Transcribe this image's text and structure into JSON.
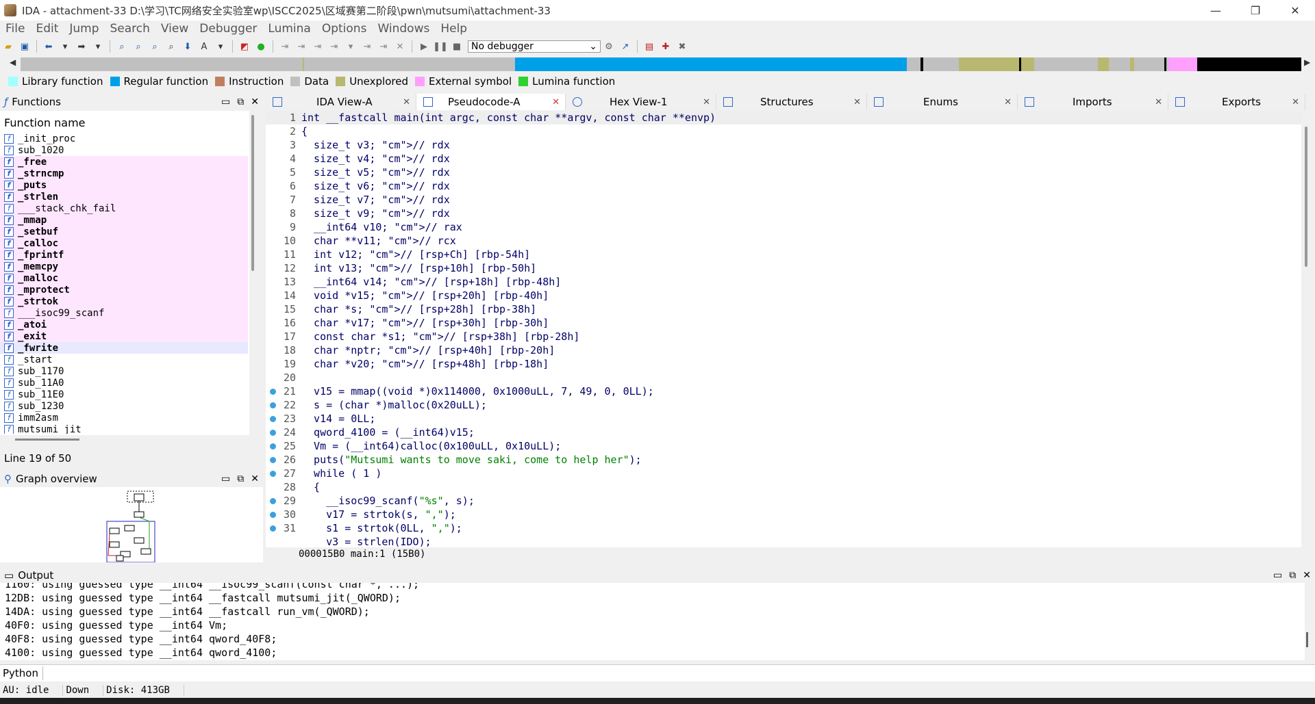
{
  "window": {
    "title": "IDA - attachment-33 D:\\学习\\TC网络安全实验室wp\\ISCC2025\\区域赛第二阶段\\pwn\\mutsumi\\attachment-33",
    "minimize": "—",
    "maximize": "❐",
    "close": "✕"
  },
  "menu": [
    "File",
    "Edit",
    "Jump",
    "Search",
    "View",
    "Debugger",
    "Lumina",
    "Options",
    "Windows",
    "Help"
  ],
  "toolbar": {
    "debugger_select": "No debugger"
  },
  "legend": [
    {
      "label": "Library function",
      "color": "#a0ffff"
    },
    {
      "label": "Regular function",
      "color": "#00a0e8"
    },
    {
      "label": "Instruction",
      "color": "#c08060"
    },
    {
      "label": "Data",
      "color": "#c0c0c0"
    },
    {
      "label": "Unexplored",
      "color": "#b8b870"
    },
    {
      "label": "External symbol",
      "color": "#ffa0ff"
    },
    {
      "label": "Lumina function",
      "color": "#30d030"
    }
  ],
  "functions_panel": {
    "title": "Functions",
    "column_header": "Function name",
    "items": [
      {
        "name": "_init_proc",
        "kind": "normal"
      },
      {
        "name": "sub_1020",
        "kind": "normal"
      },
      {
        "name": "_free",
        "kind": "external"
      },
      {
        "name": "_strncmp",
        "kind": "external"
      },
      {
        "name": "_puts",
        "kind": "external"
      },
      {
        "name": "_strlen",
        "kind": "external"
      },
      {
        "name": "___stack_chk_fail",
        "kind": "external-light"
      },
      {
        "name": "_mmap",
        "kind": "external"
      },
      {
        "name": "_setbuf",
        "kind": "external"
      },
      {
        "name": "_calloc",
        "kind": "external"
      },
      {
        "name": "_fprintf",
        "kind": "external"
      },
      {
        "name": "_memcpy",
        "kind": "external"
      },
      {
        "name": "_malloc",
        "kind": "external"
      },
      {
        "name": "_mprotect",
        "kind": "external"
      },
      {
        "name": "_strtok",
        "kind": "external"
      },
      {
        "name": "___isoc99_scanf",
        "kind": "external-light"
      },
      {
        "name": "_atoi",
        "kind": "external"
      },
      {
        "name": "_exit",
        "kind": "external"
      },
      {
        "name": "_fwrite",
        "kind": "selected"
      },
      {
        "name": "_start",
        "kind": "normal"
      },
      {
        "name": "sub_1170",
        "kind": "normal"
      },
      {
        "name": "sub_11A0",
        "kind": "normal"
      },
      {
        "name": "sub_11E0",
        "kind": "normal"
      },
      {
        "name": "sub_1230",
        "kind": "normal"
      },
      {
        "name": "imm2asm",
        "kind": "normal"
      },
      {
        "name": "mutsumi_jit",
        "kind": "normal"
      }
    ],
    "line_status": "Line 19 of 50"
  },
  "graph_panel": {
    "title": "Graph overview"
  },
  "tabs": [
    {
      "label": "IDA View-A",
      "active": false
    },
    {
      "label": "Pseudocode-A",
      "active": true
    },
    {
      "label": "Hex View-1",
      "active": false
    },
    {
      "label": "Structures",
      "active": false
    },
    {
      "label": "Enums",
      "active": false
    },
    {
      "label": "Imports",
      "active": false
    },
    {
      "label": "Exports",
      "active": false
    }
  ],
  "code_lines": [
    {
      "n": "1",
      "bp": false,
      "t": "int __fastcall main(int argc, const char **argv, const char **envp)"
    },
    {
      "n": "2",
      "bp": false,
      "t": "{"
    },
    {
      "n": "3",
      "bp": false,
      "t": "  size_t v3; // rdx"
    },
    {
      "n": "4",
      "bp": false,
      "t": "  size_t v4; // rdx"
    },
    {
      "n": "5",
      "bp": false,
      "t": "  size_t v5; // rdx"
    },
    {
      "n": "6",
      "bp": false,
      "t": "  size_t v6; // rdx"
    },
    {
      "n": "7",
      "bp": false,
      "t": "  size_t v7; // rdx"
    },
    {
      "n": "8",
      "bp": false,
      "t": "  size_t v9; // rdx"
    },
    {
      "n": "9",
      "bp": false,
      "t": "  __int64 v10; // rax"
    },
    {
      "n": "10",
      "bp": false,
      "t": "  char **v11; // rcx"
    },
    {
      "n": "11",
      "bp": false,
      "t": "  int v12; // [rsp+Ch] [rbp-54h]"
    },
    {
      "n": "12",
      "bp": false,
      "t": "  int v13; // [rsp+10h] [rbp-50h]"
    },
    {
      "n": "13",
      "bp": false,
      "t": "  __int64 v14; // [rsp+18h] [rbp-48h]"
    },
    {
      "n": "14",
      "bp": false,
      "t": "  void *v15; // [rsp+20h] [rbp-40h]"
    },
    {
      "n": "15",
      "bp": false,
      "t": "  char *s; // [rsp+28h] [rbp-38h]"
    },
    {
      "n": "16",
      "bp": false,
      "t": "  char *v17; // [rsp+30h] [rbp-30h]"
    },
    {
      "n": "17",
      "bp": false,
      "t": "  const char *s1; // [rsp+38h] [rbp-28h]"
    },
    {
      "n": "18",
      "bp": false,
      "t": "  char *nptr; // [rsp+40h] [rbp-20h]"
    },
    {
      "n": "19",
      "bp": false,
      "t": "  char *v20; // [rsp+48h] [rbp-18h]"
    },
    {
      "n": "20",
      "bp": false,
      "t": ""
    },
    {
      "n": "21",
      "bp": true,
      "t": "  v15 = mmap((void *)0x114000, 0x1000uLL, 7, 49, 0, 0LL);"
    },
    {
      "n": "22",
      "bp": true,
      "t": "  s = (char *)malloc(0x20uLL);"
    },
    {
      "n": "23",
      "bp": true,
      "t": "  v14 = 0LL;"
    },
    {
      "n": "24",
      "bp": true,
      "t": "  qword_4100 = (__int64)v15;"
    },
    {
      "n": "25",
      "bp": true,
      "t": "  Vm = (__int64)calloc(0x100uLL, 0x10uLL);"
    },
    {
      "n": "26",
      "bp": true,
      "t": "  puts(\"Mutsumi wants to move saki, come to help her\");"
    },
    {
      "n": "27",
      "bp": true,
      "t": "  while ( 1 )"
    },
    {
      "n": "28",
      "bp": false,
      "t": "  {"
    },
    {
      "n": "29",
      "bp": true,
      "t": "    __isoc99_scanf(\"%s\", s);"
    },
    {
      "n": "30",
      "bp": true,
      "t": "    v17 = strtok(s, \",\");"
    },
    {
      "n": "31",
      "bp": true,
      "t": "    s1 = strtok(0LL, \",\");"
    },
    {
      "n": "",
      "bp": false,
      "t": "    v3 = strlen(IDO);"
    }
  ],
  "code_status": "000015B0 main:1 (15B0)",
  "output_panel": {
    "title": "Output",
    "lines": [
      "1160: using guessed type __int64 __isoc99_scanf(const char *, ...);",
      "12DB: using guessed type __int64 __fastcall mutsumi_jit(_QWORD);",
      "14DA: using guessed type __int64 __fastcall run_vm(_QWORD);",
      "40F0: using guessed type __int64 Vm;",
      "40F8: using guessed type __int64 qword_40F8;",
      "4100: using guessed type __int64 qword_4100;"
    ]
  },
  "python_button": "Python",
  "status": {
    "au": "AU:  idle",
    "dir": "Down",
    "disk": "Disk: 413GB"
  }
}
